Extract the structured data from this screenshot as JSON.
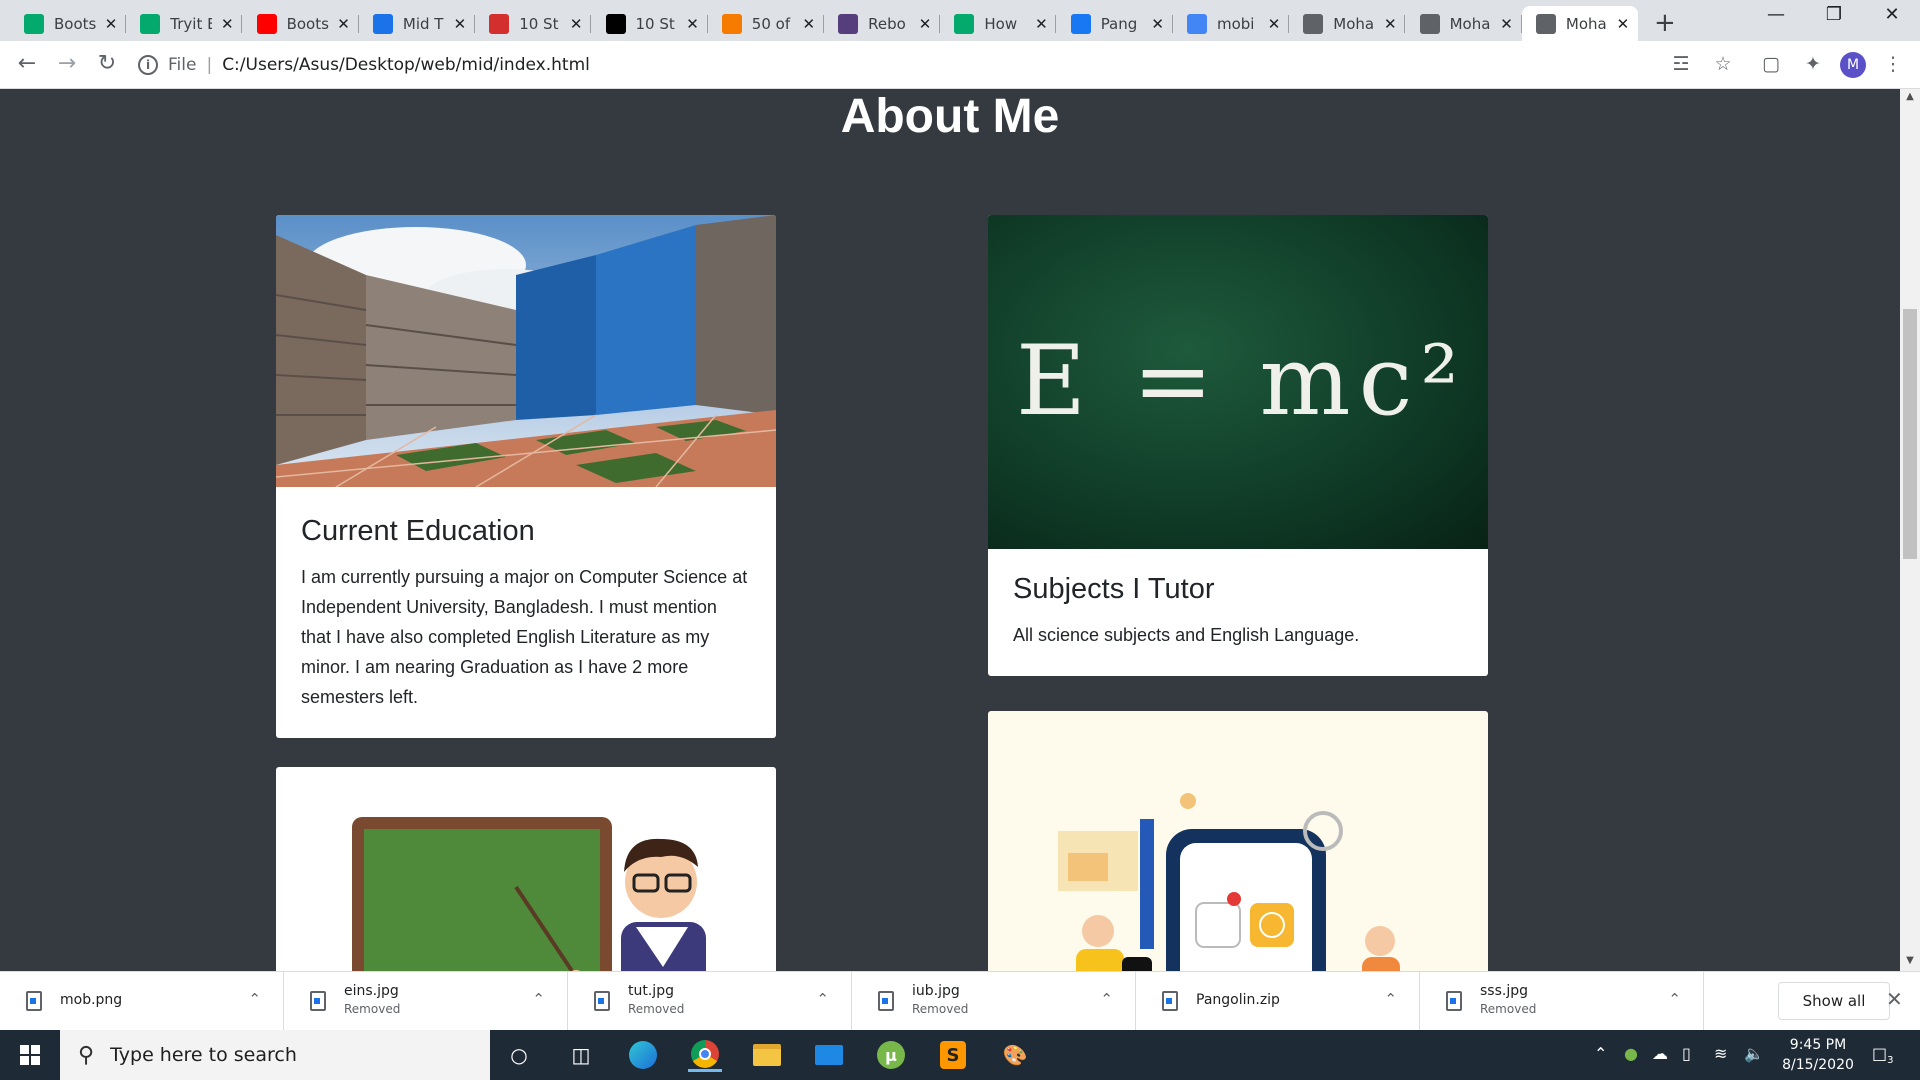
{
  "tabs": [
    {
      "label": "Boots",
      "favicon": "w3schools-icon",
      "color": "#04aa6d"
    },
    {
      "label": "Tryit E",
      "favicon": "w3schools-icon",
      "color": "#04aa6d"
    },
    {
      "label": "Boots",
      "favicon": "youtube-icon",
      "color": "#ff0000"
    },
    {
      "label": "Mid T",
      "favicon": "contact-icon",
      "color": "#1a73e8"
    },
    {
      "label": "10 St",
      "favicon": "ss-icon",
      "color": "#d32f2f"
    },
    {
      "label": "10 St",
      "favicon": "medium-icon",
      "color": "#000000"
    },
    {
      "label": "50 of",
      "favicon": "shop-icon",
      "color": "#f57c00"
    },
    {
      "label": "Rebo",
      "favicon": "bootstrap-icon",
      "color": "#563d7c"
    },
    {
      "label": "How",
      "favicon": "w3schools-icon",
      "color": "#04aa6d"
    },
    {
      "label": "Pang",
      "favicon": "facebook-icon",
      "color": "#1877f2"
    },
    {
      "label": "mobi",
      "favicon": "google-icon",
      "color": "#4285f4"
    },
    {
      "label": "Moha",
      "favicon": "globe-icon",
      "color": "#5f6368"
    },
    {
      "label": "Moha",
      "favicon": "globe-icon",
      "color": "#5f6368"
    },
    {
      "label": "Moha",
      "favicon": "globe-icon",
      "color": "#5f6368"
    }
  ],
  "omnibox": {
    "scheme": "File",
    "url": "C:/Users/Asus/Desktop/web/mid/index.html"
  },
  "profile_initial": "M",
  "page": {
    "title": "About Me",
    "cards": [
      {
        "title": "Current Education",
        "text": "I am currently pursuing a major on Computer Science at Independent University, Bangladesh. I must mention that I have also completed English Literature as my minor. I am nearing Graduation as I have 2 more semesters left."
      },
      {
        "title": "Subjects I Tutor",
        "text": "All science subjects and English Language.",
        "image_text": "E = mc²"
      }
    ]
  },
  "downloads": [
    {
      "name": "mob.png",
      "status": ""
    },
    {
      "name": "eins.jpg",
      "status": "Removed"
    },
    {
      "name": "tut.jpg",
      "status": "Removed"
    },
    {
      "name": "iub.jpg",
      "status": "Removed"
    },
    {
      "name": "Pangolin.zip",
      "status": ""
    },
    {
      "name": "sss.jpg",
      "status": "Removed"
    }
  ],
  "shelf": {
    "show_all": "Show all"
  },
  "taskbar": {
    "search_placeholder": "Type here to search",
    "time": "9:45 PM",
    "date": "8/15/2020",
    "notifications": "3"
  }
}
